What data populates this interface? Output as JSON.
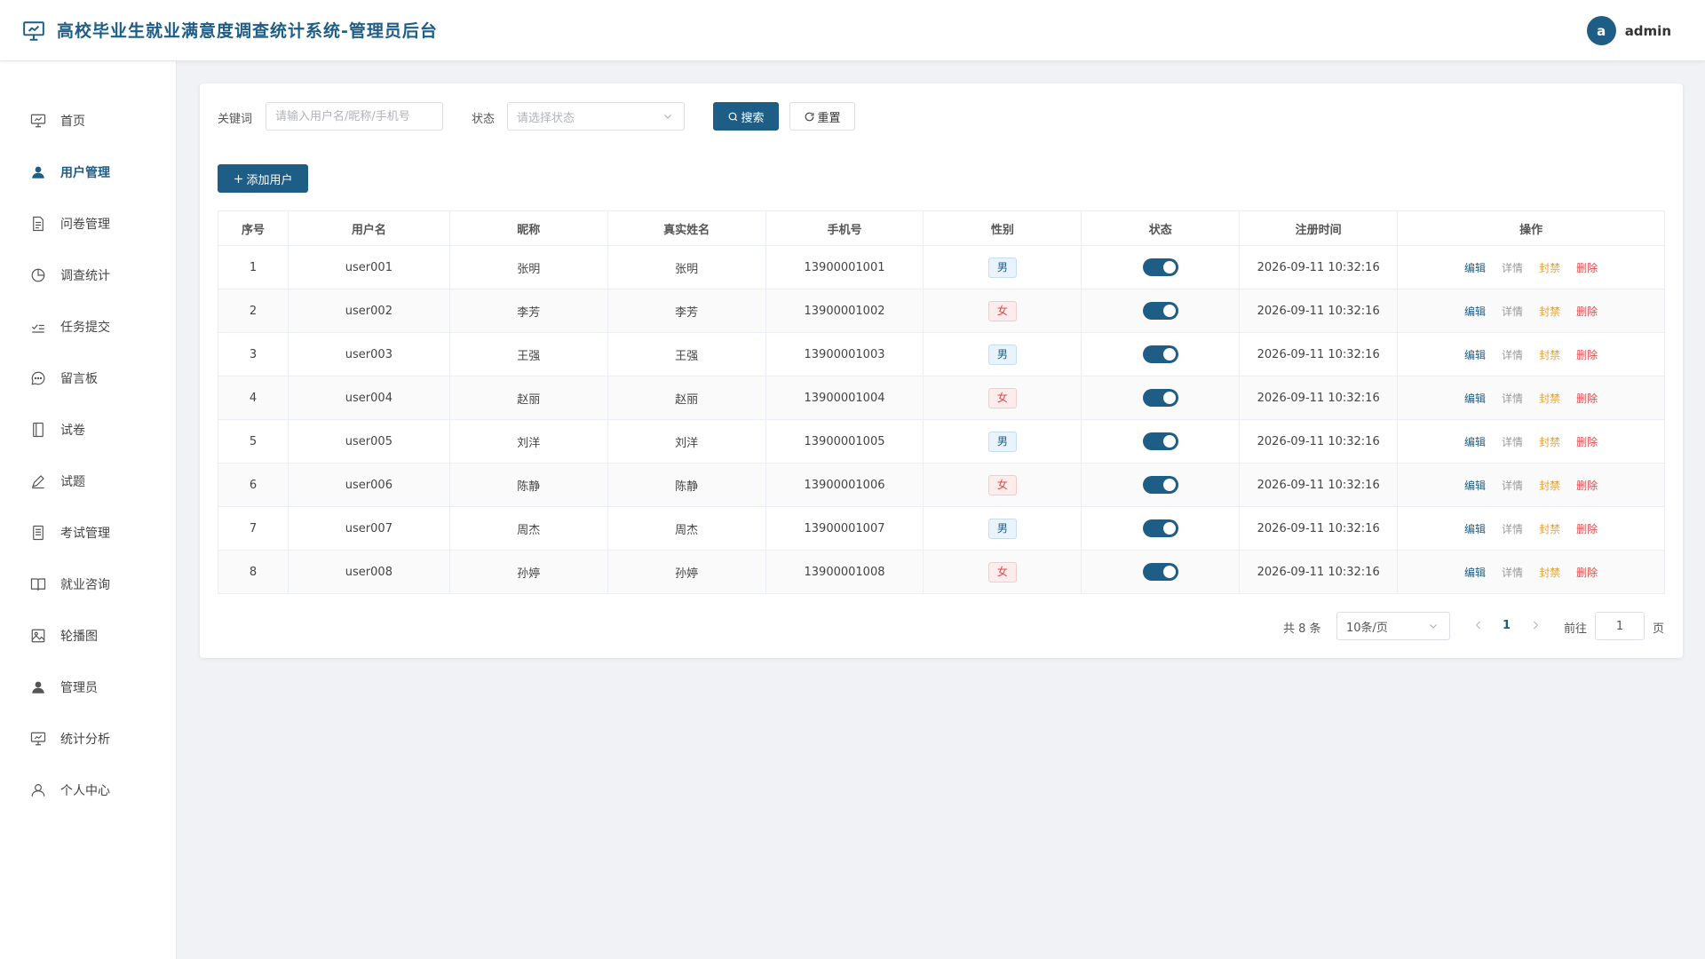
{
  "header": {
    "title": "高校毕业生就业满意度调查统计系统-管理员后台",
    "avatar_letter": "a",
    "user_name": "admin",
    "accent": "#1e5d86"
  },
  "sidebar": {
    "items": [
      {
        "label": "首页",
        "icon": "presentation-icon",
        "active": false
      },
      {
        "label": "用户管理",
        "icon": "user-filled-icon",
        "active": true
      },
      {
        "label": "问卷管理",
        "icon": "document-icon",
        "active": false
      },
      {
        "label": "调查统计",
        "icon": "pie-chart-icon",
        "active": false
      },
      {
        "label": "任务提交",
        "icon": "checklist-icon",
        "active": false
      },
      {
        "label": "留言板",
        "icon": "chat-bubble-icon",
        "active": false
      },
      {
        "label": "试卷",
        "icon": "notebook-icon",
        "active": false
      },
      {
        "label": "试题",
        "icon": "pen-icon",
        "active": false
      },
      {
        "label": "考试管理",
        "icon": "list-document-icon",
        "active": false
      },
      {
        "label": "就业咨询",
        "icon": "book-open-icon",
        "active": false
      },
      {
        "label": "轮播图",
        "icon": "picture-icon",
        "active": false
      },
      {
        "label": "管理员",
        "icon": "user-filled-icon",
        "active": false
      },
      {
        "label": "统计分析",
        "icon": "presentation-icon",
        "active": false
      },
      {
        "label": "个人中心",
        "icon": "user-outline-icon",
        "active": false
      }
    ]
  },
  "filters": {
    "keyword_label": "关键词",
    "keyword_placeholder": "请输入用户名/昵称/手机号",
    "status_label": "状态",
    "status_placeholder": "请选择状态",
    "search_label": "搜索",
    "reset_label": "重置"
  },
  "add_button_label": "添加用户",
  "table": {
    "headers": [
      "序号",
      "用户名",
      "昵称",
      "真实姓名",
      "手机号",
      "性别",
      "状态",
      "注册时间",
      "操作"
    ],
    "ops": {
      "edit": "编辑",
      "detail": "详情",
      "ban": "封禁",
      "delete": "删除"
    },
    "rows": [
      {
        "index": "1",
        "username": "user001",
        "nickname": "张明",
        "realname": "张明",
        "phone": "13900001001",
        "gender": "男",
        "status_on": true,
        "registered": "2026-09-11 10:32:16"
      },
      {
        "index": "2",
        "username": "user002",
        "nickname": "李芳",
        "realname": "李芳",
        "phone": "13900001002",
        "gender": "女",
        "status_on": true,
        "registered": "2026-09-11 10:32:16"
      },
      {
        "index": "3",
        "username": "user003",
        "nickname": "王强",
        "realname": "王强",
        "phone": "13900001003",
        "gender": "男",
        "status_on": true,
        "registered": "2026-09-11 10:32:16"
      },
      {
        "index": "4",
        "username": "user004",
        "nickname": "赵丽",
        "realname": "赵丽",
        "phone": "13900001004",
        "gender": "女",
        "status_on": true,
        "registered": "2026-09-11 10:32:16"
      },
      {
        "index": "5",
        "username": "user005",
        "nickname": "刘洋",
        "realname": "刘洋",
        "phone": "13900001005",
        "gender": "男",
        "status_on": true,
        "registered": "2026-09-11 10:32:16"
      },
      {
        "index": "6",
        "username": "user006",
        "nickname": "陈静",
        "realname": "陈静",
        "phone": "13900001006",
        "gender": "女",
        "status_on": true,
        "registered": "2026-09-11 10:32:16"
      },
      {
        "index": "7",
        "username": "user007",
        "nickname": "周杰",
        "realname": "周杰",
        "phone": "13900001007",
        "gender": "男",
        "status_on": true,
        "registered": "2026-09-11 10:32:16"
      },
      {
        "index": "8",
        "username": "user008",
        "nickname": "孙婷",
        "realname": "孙婷",
        "phone": "13900001008",
        "gender": "女",
        "status_on": true,
        "registered": "2026-09-11 10:32:16"
      }
    ]
  },
  "pagination": {
    "total": "共 8 条",
    "page_size": "10条/页",
    "current_page": "1",
    "goto_prefix": "前往",
    "goto_value": "1",
    "goto_suffix": "页"
  }
}
